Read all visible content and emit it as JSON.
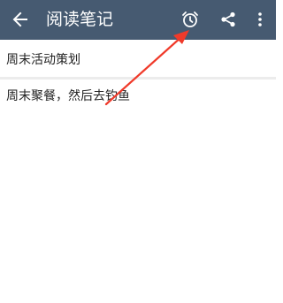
{
  "toolbar": {
    "title": "阅读笔记",
    "back_icon": "arrow-left-icon",
    "alarm_icon": "alarm-clock-icon",
    "share_icon": "share-icon",
    "more_icon": "more-vertical-icon",
    "background_color": "#465a71"
  },
  "note": {
    "title": "周末活动策划",
    "body": "周末聚餐，然后去钓鱼"
  },
  "annotation": {
    "arrow_color": "#f03a2a",
    "arrow_target": "alarm-clock-icon"
  }
}
